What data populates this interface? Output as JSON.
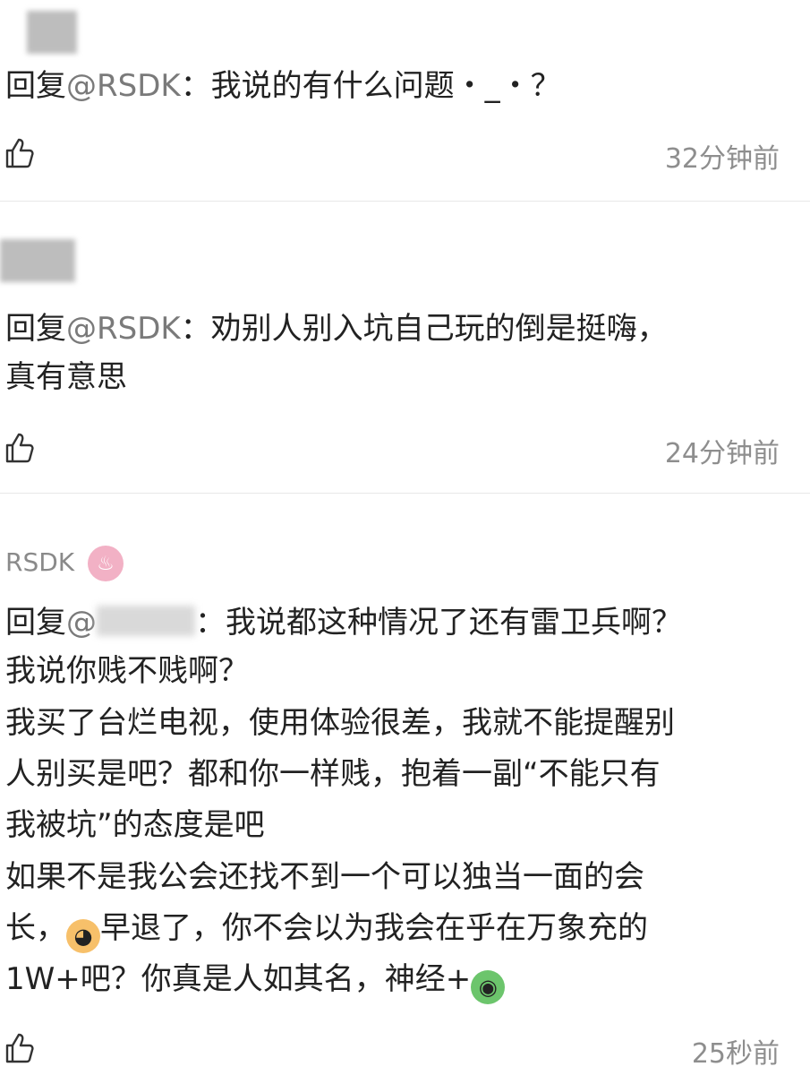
{
  "comments": [
    {
      "reply_prefix": "回复",
      "mention": "@RSDK",
      "text": "：我说的有什么问题・_・？",
      "time": "32分钟前"
    },
    {
      "reply_prefix": "回复",
      "mention": "@RSDK",
      "text": "：劝别人别入坑自己玩的倒是挺嗨，",
      "text_line2": "真有意思",
      "time": "24分钟前"
    },
    {
      "username": "RSDK",
      "reply_prefix": "回复",
      "mention_partial": "@",
      "lines": [
        "：我说都这种情况了还有雷卫兵啊？",
        "我说你贱不贱啊？",
        "我买了台烂电视，使用体验很差，我就不能提醒别",
        "人别买是吧？都和你一样贱，抱着一副“不能只有",
        "我被坑”的态度是吧",
        "如果不是我公会还找不到一个可以独当一面的会"
      ],
      "line7_a": "长，",
      "line7_b": "早退了，你不会以为我会在乎在万象充的",
      "line8": "1W+吧？你真是人如其名，神经+",
      "time": "25秒前"
    }
  ],
  "icons": {
    "like": "thumbs-up-icon",
    "badge": "fire-badge-icon"
  },
  "colors": {
    "divider": "#e8e8e8",
    "time": "#8e8e8e",
    "mention": "#7a7a7a",
    "badge": "#f2b1c5"
  }
}
